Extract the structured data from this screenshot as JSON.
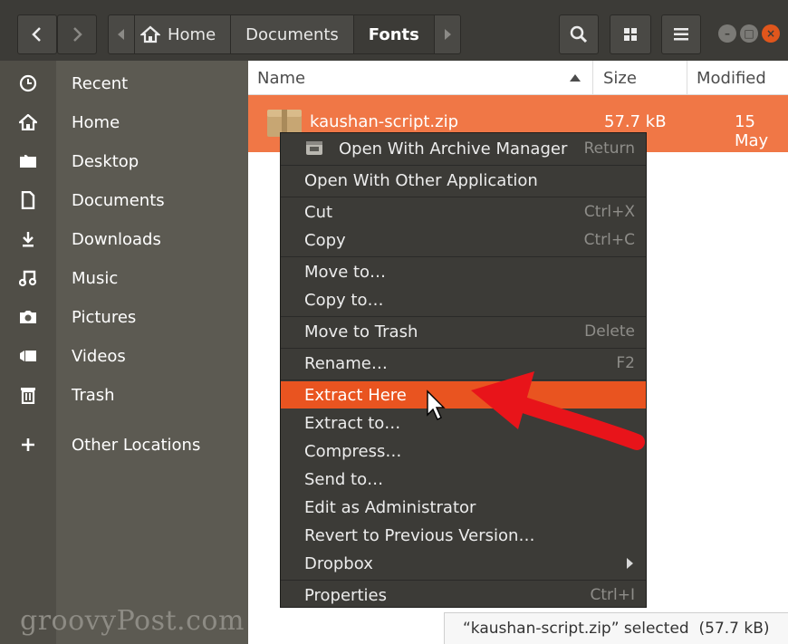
{
  "toolbar": {
    "path": [
      "Home",
      "Documents",
      "Fonts"
    ],
    "active_path": "Fonts"
  },
  "sidebar": {
    "items": [
      {
        "label": "Recent",
        "icon": "clock-icon"
      },
      {
        "label": "Home",
        "icon": "home-icon"
      },
      {
        "label": "Desktop",
        "icon": "folder-icon"
      },
      {
        "label": "Documents",
        "icon": "document-icon"
      },
      {
        "label": "Downloads",
        "icon": "download-icon"
      },
      {
        "label": "Music",
        "icon": "music-icon"
      },
      {
        "label": "Pictures",
        "icon": "camera-icon"
      },
      {
        "label": "Videos",
        "icon": "video-icon"
      },
      {
        "label": "Trash",
        "icon": "trash-icon"
      }
    ],
    "other": {
      "label": "Other Locations",
      "icon": "plus-icon"
    }
  },
  "file_list": {
    "columns": {
      "name": "Name",
      "size": "Size",
      "modified": "Modified"
    },
    "sort": "name-ascending",
    "rows": [
      {
        "name": "kaushan-script.zip",
        "size": "57.7 kB",
        "modified": "15 May",
        "selected": true
      }
    ]
  },
  "context_menu": {
    "items": [
      {
        "label": "Open With Archive Manager",
        "shortcut": "Return"
      },
      {
        "label": "Open With Other Application",
        "shortcut": ""
      },
      {
        "label": "Cut",
        "shortcut": "Ctrl+X"
      },
      {
        "label": "Copy",
        "shortcut": "Ctrl+C"
      },
      {
        "label": "Move to…",
        "shortcut": ""
      },
      {
        "label": "Copy to…",
        "shortcut": ""
      },
      {
        "label": "Move to Trash",
        "shortcut": "Delete"
      },
      {
        "label": "Rename…",
        "shortcut": "F2"
      },
      {
        "label": "Extract Here",
        "shortcut": "",
        "highlighted": true
      },
      {
        "label": "Extract to…",
        "shortcut": ""
      },
      {
        "label": "Compress…",
        "shortcut": ""
      },
      {
        "label": "Send to…",
        "shortcut": ""
      },
      {
        "label": "Edit as Administrator",
        "shortcut": ""
      },
      {
        "label": "Revert to Previous Version…",
        "shortcut": ""
      },
      {
        "label": "Dropbox",
        "shortcut": ""
      },
      {
        "label": "Properties",
        "shortcut": "Ctrl+I"
      }
    ]
  },
  "status": {
    "text": "“kaushan-script.zip” selected  (57.7 kB)"
  },
  "watermark": "groovyPost.com",
  "colors": {
    "accent": "#e95420",
    "selection": "#f07746",
    "annotation_arrow": "#e8141a"
  }
}
